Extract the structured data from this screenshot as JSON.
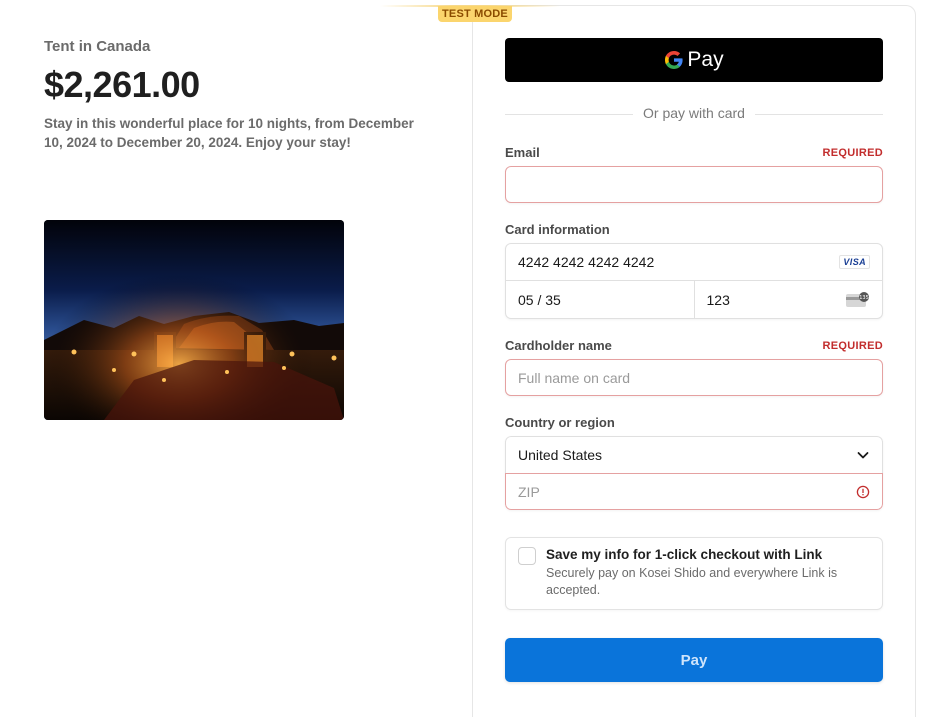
{
  "badge": {
    "test_mode": "TEST MODE"
  },
  "product": {
    "name": "Tent in Canada",
    "price": "$2,261.00",
    "description": "Stay in this wonderful place for 10 nights, from December 10, 2024 to December 20, 2024. Enjoy your stay!"
  },
  "gpay": {
    "label": "Pay"
  },
  "divider": {
    "text": "Or pay with card"
  },
  "email": {
    "label": "Email",
    "required": "REQUIRED",
    "value": ""
  },
  "card": {
    "label": "Card information",
    "number": "4242 4242 4242 4242",
    "brand": "VISA",
    "expiry": "05 / 35",
    "cvc": "123"
  },
  "cardholder": {
    "label": "Cardholder name",
    "required": "REQUIRED",
    "placeholder": "Full name on card"
  },
  "country": {
    "label": "Country or region",
    "selected": "United States",
    "zip_placeholder": "ZIP"
  },
  "link": {
    "title": "Save my info for 1-click checkout with Link",
    "subtitle": "Securely pay on Kosei Shido and everywhere Link is accepted."
  },
  "pay_button": {
    "label": "Pay"
  },
  "colors": {
    "accent": "#0a74da",
    "error": "#c22d2d",
    "badge": "#fbd56d"
  }
}
